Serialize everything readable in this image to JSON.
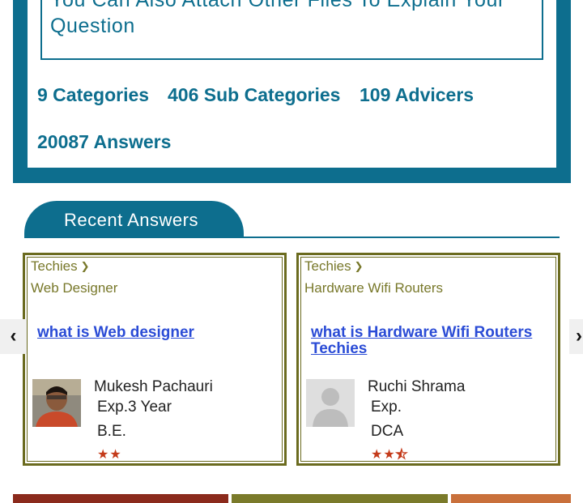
{
  "upload": {
    "text": "You Can Also Attach Other Files To Explain Your Question"
  },
  "stats": {
    "categories": "9 Categories",
    "sub_categories": "406 Sub Categories",
    "advisers": "109 Advicers",
    "answers": "20087 Answers"
  },
  "section": {
    "title": "Recent Answers"
  },
  "cards": [
    {
      "category": "Techies",
      "subcategory": "Web Designer",
      "question": "what is Web designer",
      "author": "Mukesh Pachauri",
      "experience": "Exp.3 Year",
      "education": "B.E.",
      "rating": 2
    },
    {
      "category": "Techies",
      "subcategory": "Hardware Wifi Routers",
      "question": "what is Hardware Wifi Routers Techies",
      "author": "Ruchi Shrama",
      "experience": "Exp.",
      "education": "DCA",
      "rating": 2.5
    }
  ],
  "nav": {
    "prev_icon": "chevron-left-icon",
    "next_icon": "chevron-right-icon"
  },
  "colors": {
    "primary": "#0d6e8e",
    "olive": "#6b6b1f",
    "link": "#2b4cd6",
    "star": "#c43a1a",
    "bar1": "#8b2a1c",
    "bar2": "#7a7a2a",
    "bar3": "#c9703b"
  }
}
